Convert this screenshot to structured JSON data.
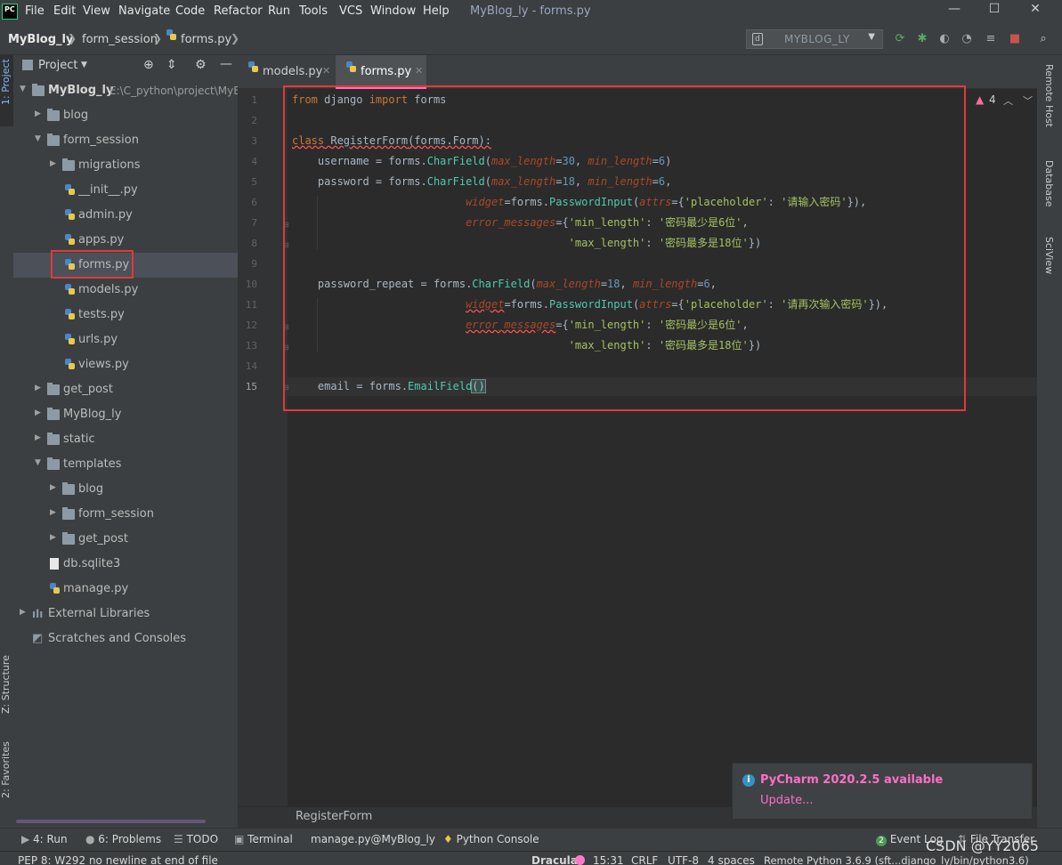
{
  "menubar": {
    "logo": "PC",
    "items": [
      "File",
      "Edit",
      "View",
      "Navigate",
      "Code",
      "Refactor",
      "Run",
      "Tools",
      "VCS",
      "Window",
      "Help"
    ],
    "window_title": "MyBlog_ly - forms.py",
    "minimize": "—",
    "maximize": "☐",
    "close": "✕"
  },
  "navbar": {
    "crumbs": [
      "MyBlog_ly",
      "form_session",
      "forms.py"
    ],
    "run_config": "MYBLOG_LY"
  },
  "left_strip": {
    "project_tab": "1: Project",
    "structure_tab": "Z: Structure",
    "favorites_tab": "2: Favorites"
  },
  "project": {
    "title": "Project",
    "root_name": "MyBlog_ly",
    "root_path": "E:\\C_python\\project\\MyB",
    "items": [
      {
        "label": "blog"
      },
      {
        "label": "form_session"
      },
      {
        "label": "migrations"
      },
      {
        "label": "__init__.py"
      },
      {
        "label": "admin.py"
      },
      {
        "label": "apps.py"
      },
      {
        "label": "forms.py"
      },
      {
        "label": "models.py"
      },
      {
        "label": "tests.py"
      },
      {
        "label": "urls.py"
      },
      {
        "label": "views.py"
      },
      {
        "label": "get_post"
      },
      {
        "label": "MyBlog_ly"
      },
      {
        "label": "static"
      },
      {
        "label": "templates"
      },
      {
        "label": "blog"
      },
      {
        "label": "form_session"
      },
      {
        "label": "get_post"
      },
      {
        "label": "db.sqlite3"
      },
      {
        "label": "manage.py"
      },
      {
        "label": "External Libraries"
      },
      {
        "label": "Scratches and Consoles"
      }
    ]
  },
  "tabs": [
    {
      "label": "models.py"
    },
    {
      "label": "forms.py"
    }
  ],
  "editor": {
    "warning_count": "4",
    "line_numbers": [
      "1",
      "2",
      "3",
      "4",
      "5",
      "6",
      "7",
      "8",
      "9",
      "10",
      "11",
      "12",
      "13",
      "14",
      "15"
    ],
    "code": {
      "l1": {
        "kw": "from",
        "mod": " django ",
        "kw2": "import",
        "name": " forms"
      },
      "l3": {
        "kw": "class",
        "cls": "RegisterForm",
        "rest": "(forms.Form):"
      },
      "l4": {
        "pre": "    username = forms.",
        "fn": "CharField",
        "p1": "max_length",
        "eq1": "=",
        "n1": "30",
        "sep": ", ",
        "p2": "min_length",
        "eq2": "=",
        "n2": "6",
        "end": ")"
      },
      "l5": {
        "pre": "    password = forms.",
        "fn": "CharField",
        "p1": "max_length",
        "eq1": "=",
        "n1": "18",
        "sep": ", ",
        "p2": "min_length",
        "eq2": "=",
        "n2": "6",
        "end": ","
      },
      "l6": {
        "pre": "                           ",
        "p": "widget",
        "mid": "=forms.",
        "fn": "PasswordInput",
        "open": "(",
        "p2": "attrs",
        "mid2": "={",
        "s1": "'placeholder'",
        "colon": ": ",
        "s2": "'请输入密码'",
        "end": "}),"
      },
      "l7": {
        "pre": "                           ",
        "p": "error_messages",
        "mid": "={",
        "s1": "'min_length'",
        "colon": ": ",
        "s2": "'密码最少是6位'",
        "end": ","
      },
      "l8": {
        "pre": "                                           ",
        "s1": "'max_length'",
        "colon": ": ",
        "s2": "'密码最多是18位'",
        "end": "})"
      },
      "l10": {
        "pre": "    password_repeat = forms.",
        "fn": "CharField",
        "p1": "max_length",
        "eq1": "=",
        "n1": "18",
        "sep": ", ",
        "p2": "min_length",
        "eq2": "=",
        "n2": "6",
        "end": ","
      },
      "l11": {
        "pre": "                           ",
        "p": "widget",
        "mid": "=forms.",
        "fn": "PasswordInput",
        "open": "(",
        "p2": "attrs",
        "mid2": "={",
        "s1": "'placeholder'",
        "colon": ": ",
        "s2": "'请再次输入密码'",
        "end": "}),"
      },
      "l12": {
        "pre": "                           ",
        "p": "error_messages",
        "mid": "={",
        "s1": "'min_length'",
        "colon": ": ",
        "s2": "'密码最少是6位'",
        "end": ","
      },
      "l13": {
        "pre": "                                           ",
        "s1": "'max_length'",
        "colon": ": ",
        "s2": "'密码最多是18位'",
        "end": "})"
      },
      "l15": {
        "pre": "    email = forms.",
        "fn": "EmailField",
        "paren": "()"
      }
    }
  },
  "right_strip": {
    "remote_host": "Remote Host",
    "database": "Database",
    "sciview": "SciView"
  },
  "structure_crumb": "RegisterForm",
  "notification": {
    "title": "PyCharm 2020.2.5 available",
    "link": "Update..."
  },
  "bottom_tools": {
    "run": "4: Run",
    "problems": "6: Problems",
    "todo": "TODO",
    "terminal": "Terminal",
    "manage": "manage.py@MyBlog_ly",
    "python_console": "Python Console",
    "event_log": "Event Log",
    "event_log_count": "2",
    "file_transfer": "File Transfer"
  },
  "status": {
    "message": "PEP 8: W292 no newline at end of file",
    "theme": "Dracula",
    "position": "15:31",
    "line_sep": "CRLF",
    "encoding": "UTF-8",
    "indent": "4 spaces",
    "interpreter": "Remote Python 3.6.9 (sft...django_ly/bin/python3.6)"
  },
  "watermark": "CSDN @YY2065",
  "colors": {
    "accent": "#ff6ec7",
    "highlight_border": "#e03a3a"
  }
}
